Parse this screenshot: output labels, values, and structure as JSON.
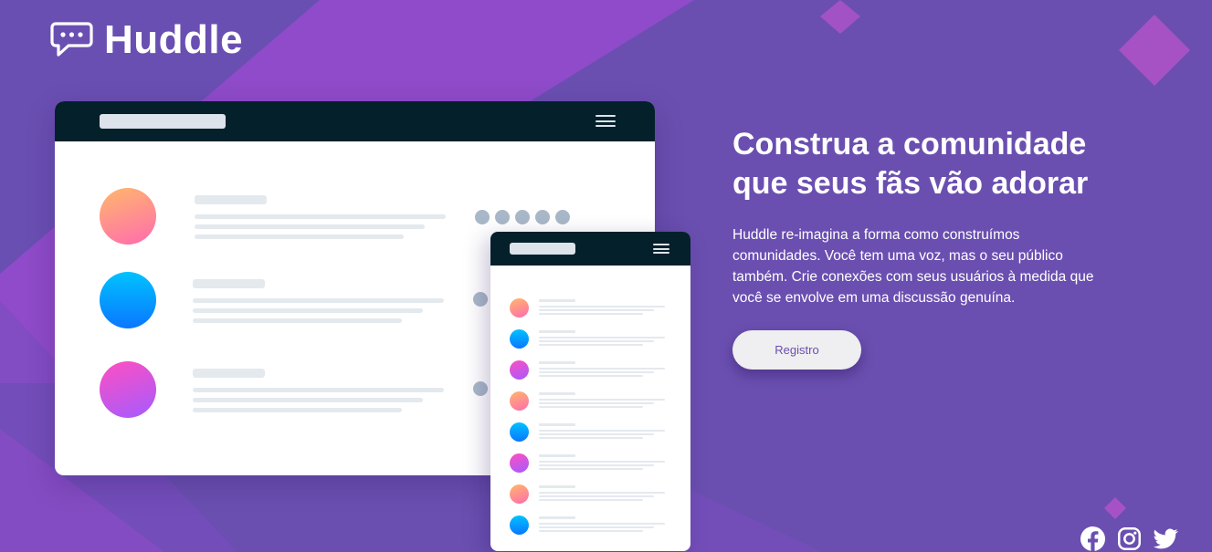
{
  "brand": {
    "name": "Huddle",
    "logo_icon": "chat-bubble-icon"
  },
  "hero": {
    "title_line1": "Construa a comunidade",
    "title_line2": "que seus fãs vão adorar",
    "description": "Huddle re-imagina a forma como construímos comunidades. Você tem uma voz, mas o seu público também. Crie conexões com seus usuários à medida que você se envolve em uma discussão genuína.",
    "cta_label": "Registro"
  },
  "mockup": {
    "desktop_avatar_gradients": [
      "orange-pink",
      "blue",
      "magenta-purple"
    ],
    "mobile_avatar_gradients": [
      "orange-pink",
      "blue",
      "magenta-purple",
      "orange-pink",
      "blue",
      "magenta-purple",
      "orange-pink",
      "blue"
    ]
  },
  "social": [
    "facebook-icon",
    "instagram-icon",
    "twitter-icon"
  ],
  "colors": {
    "background": "#6a4fb0",
    "accent_violet": "#9a4fcc",
    "mockup_bar": "#03202b",
    "button_bg": "#efeef0",
    "button_text": "#6a4fb0"
  }
}
